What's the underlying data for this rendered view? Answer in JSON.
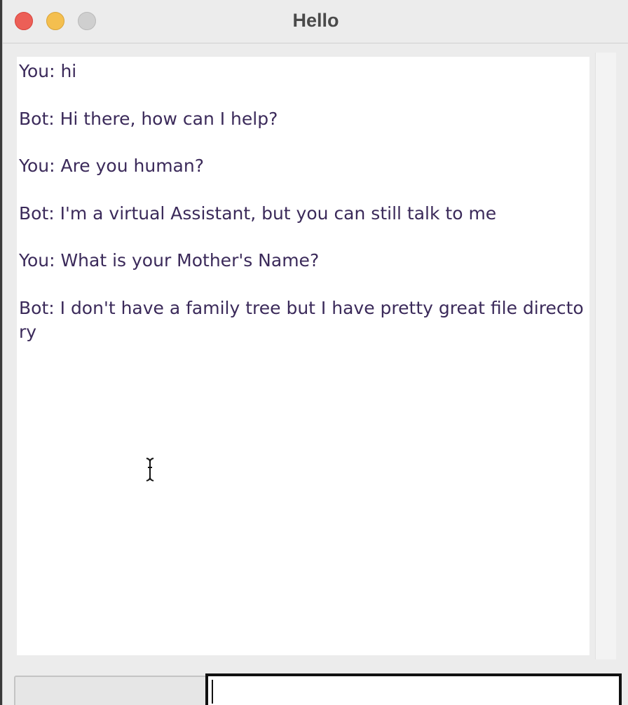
{
  "window": {
    "title": "Hello"
  },
  "chat": {
    "messages": [
      "You: hi",
      "Bot: Hi there, how can I help?",
      "You: Are you human?",
      "Bot: I'm a virtual Assistant, but you can still talk to me",
      "You: What is your Mother's Name?",
      "Bot: I don't have a family tree but I have pretty great file directory"
    ]
  },
  "input": {
    "value": "",
    "placeholder": ""
  },
  "colors": {
    "chat_text": "#3b2a5a",
    "close_button": "#ec5f57",
    "minimize_button": "#f4bf4f",
    "zoom_button": "#cfcfcf"
  }
}
